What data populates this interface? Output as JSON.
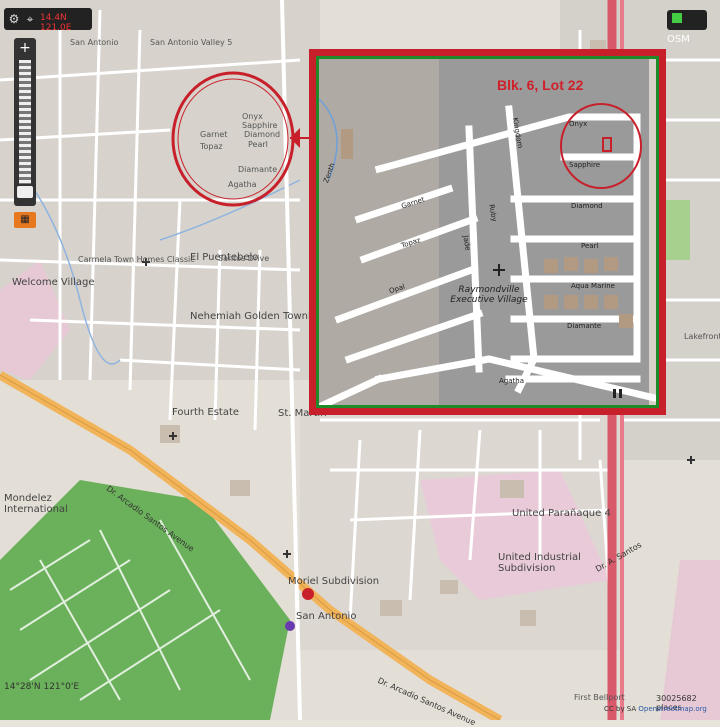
{
  "toolbar": {
    "coords_text": "14.4N 121.0E"
  },
  "osm": {
    "label": "OSM"
  },
  "zoom": {
    "plus": "+",
    "minus": "−"
  },
  "inset": {
    "title": "Blk. 6, Lot 22",
    "streets": [
      "Onyx",
      "Sapphire",
      "Diamond",
      "Pearl",
      "Aqua Marine",
      "Diamante",
      "Agatha",
      "Garnet",
      "Topaz",
      "Opal",
      "Jade",
      "Ruby",
      "Kingdom",
      "Zenth"
    ],
    "village": "Raymondville Executive Village"
  },
  "map_labels": {
    "san_antonio_valley": "San Antonio Valley 5",
    "san_antonio_valley_left": "San Antonio",
    "carmela": "Carmela Town Homes Classic",
    "welcome": "Welcome Village",
    "el_puente": "El Puentebelo",
    "nehemiah": "Nehemiah Golden Townhouses",
    "fourth_estate": "Fourth Estate",
    "st_martin": "St. Martin",
    "mondelez": "Mondelez International",
    "united_paranaque": "United Parañaque 4",
    "united_industrial": "United Industrial Subdivision",
    "moriel": "Moriel Subdivision",
    "san_antonio": "San Antonio",
    "dr_arcadio_1": "Dr. Arcadio Santos Avenue",
    "dr_arcadio_2": "Dr. Arcadio Santos Avenue",
    "dr_arcadio_3": "Dr. A. Santos",
    "diamond": "Diamond",
    "sapphire": "Sapphire",
    "onyx": "Onyx",
    "pearl": "Pearl",
    "garnet": "Garnet",
    "topaz": "Topaz",
    "diamante": "Diamante",
    "agatha": "Agatha",
    "santos_drive": "Santos Drive",
    "first_bellport": "First Bellport",
    "lakefront": "Lakefront Drive"
  },
  "footer": {
    "coords": "14°28'N 121°0'E",
    "scale": "30025682 places",
    "cc": "CC by SA",
    "osm_link": "Openstreetmap.org"
  },
  "colors": {
    "accent_red": "#c8202a",
    "inset_green": "#1e8a2a",
    "main_road": "#f2b45a",
    "park_green": "#5aa850"
  }
}
